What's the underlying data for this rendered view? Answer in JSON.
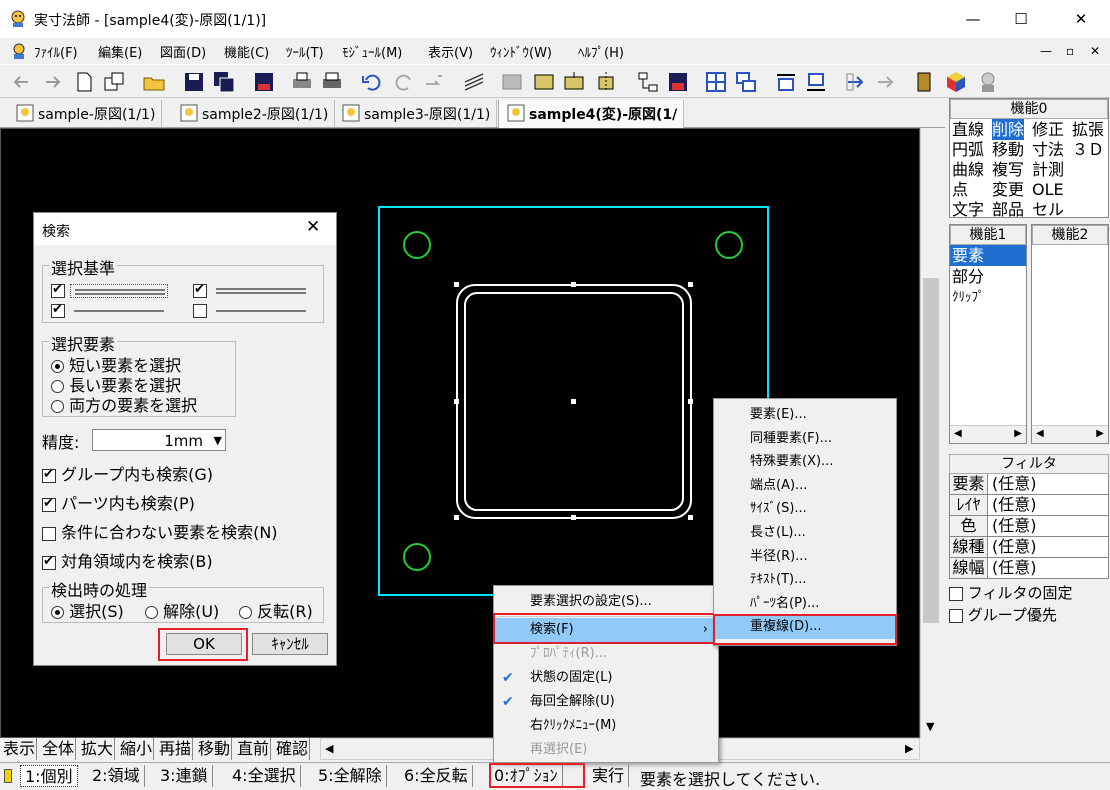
{
  "window": {
    "title": "実寸法師 - [sample4(変)-原図(1/1)]",
    "minimize": "—",
    "maximize": "☐",
    "close": "✕"
  },
  "menubar": [
    "ﾌｧｲﾙ(F)",
    "編集(E)",
    "図面(D)",
    "機能(C)",
    "ﾂｰﾙ(T)",
    "ﾓｼﾞｭｰﾙ(M)",
    "表示(V)",
    "ｳｨﾝﾄﾞｳ(W)",
    "ﾍﾙﾌﾟ(H)"
  ],
  "mdi_controls": [
    "—",
    "▫",
    "✕"
  ],
  "tabs": [
    "sample-原図(1/1)",
    "sample2-原図(1/1)",
    "sample3-原図(1/1)",
    "sample4(変)-原図(1/"
  ],
  "panel": {
    "func0_title": "機能0",
    "func0_rows": [
      [
        "直線",
        "削除",
        "修正",
        "拡張"
      ],
      [
        "円弧",
        "移動",
        "寸法",
        "３Ｄ"
      ],
      [
        "曲線",
        "複写",
        "計測",
        ""
      ],
      [
        "点",
        "変更",
        "OLE",
        ""
      ],
      [
        "文字",
        "部品",
        "セル",
        ""
      ]
    ],
    "func1_title": "機能1",
    "func1_items": [
      "要素",
      "部分",
      "ｸﾘｯﾌﾟ"
    ],
    "func2_title": "機能2",
    "filter_title": "フィルタ",
    "filter_rows": [
      [
        "要素",
        "(任意)"
      ],
      [
        "ﾚｲﾔ",
        "(任意)"
      ],
      [
        "色",
        "(任意)"
      ],
      [
        "線種",
        "(任意)"
      ],
      [
        "線幅",
        "(任意)"
      ]
    ],
    "filter_lock": "フィルタの固定",
    "group_priority": "グループ優先"
  },
  "bottom_buttons": [
    "表示",
    "全体",
    "拡大",
    "縮小",
    "再描",
    "移動",
    "直前",
    "確認"
  ],
  "status": {
    "mode_buttons": [
      "1:個別",
      "2:領域",
      "3:連鎖",
      "4:全選択",
      "5:全解除",
      "6:全反転",
      "0:ｵﾌﾟｼｮﾝ",
      "実行"
    ],
    "message": "要素を選択してください."
  },
  "dialog": {
    "title": "検索",
    "criteria_legend": "選択基準",
    "element_legend": "選択要素",
    "element_options": [
      "短い要素を選択",
      "長い要素を選択",
      "両方の要素を選択"
    ],
    "precision_label": "精度:",
    "precision_value": "1mm",
    "checks": [
      "グループ内も検索(G)",
      "パーツ内も検索(P)",
      "条件に合わない要素を検索(N)",
      "対角領域内を検索(B)"
    ],
    "found_legend": "検出時の処理",
    "found_options": [
      "選択(S)",
      "解除(U)",
      "反転(R)"
    ],
    "ok": "OK",
    "cancel": "ｷｬﾝｾﾙ"
  },
  "context_menu": {
    "items": [
      "要素選択の設定(S)...",
      "検索(F)",
      "ﾌﾟﾛﾊﾟﾃｨ(R)...",
      "状態の固定(L)",
      "毎回全解除(U)",
      "右ｸﾘｯｸﾒﾆｭｰ(M)",
      "再選択(E)"
    ]
  },
  "submenu": {
    "items": [
      "要素(E)...",
      "同種要素(F)...",
      "特殊要素(X)...",
      "端点(A)...",
      "ｻｲｽﾞ(S)...",
      "長さ(L)...",
      "半径(R)...",
      "ﾃｷｽﾄ(T)...",
      "ﾊﾟｰﾂ名(P)...",
      "重複線(D)..."
    ]
  },
  "colors": {
    "canvas": "#000000",
    "frame": "#00e5ff",
    "circle": "#22cc33",
    "highlight": "#91c9f7",
    "callout": "#e0202c"
  }
}
